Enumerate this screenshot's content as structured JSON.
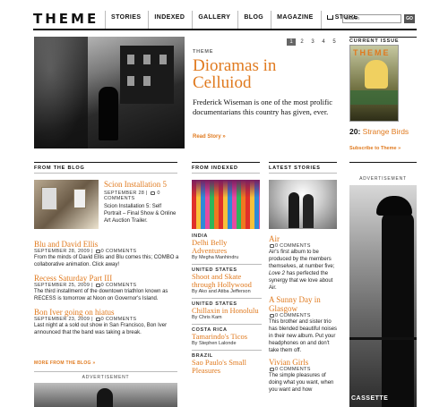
{
  "header": {
    "logo": "THEME",
    "nav": [
      "STORIES",
      "INDEXED",
      "GALLERY",
      "BLOG",
      "MAGAZINE",
      "STORE"
    ],
    "search_value": "Search",
    "go_label": "GO"
  },
  "feature": {
    "pages": [
      "1",
      "2",
      "3",
      "4",
      "5"
    ],
    "active_page": "1",
    "kicker": "THEME",
    "title": "Dioramas in Celluiod",
    "dek": "Frederick Wiseman is one of the most prolific documentarians this country has given, ever.",
    "read_more": "Read Story »"
  },
  "current_issue": {
    "label": "CURRENT ISSUE",
    "number": "20:",
    "name": "Strange Birds",
    "subscribe": "Subscribe to Theme »"
  },
  "blog": {
    "heading": "FROM THE BLOG",
    "lead": {
      "title": "Scion Installation 5",
      "date": "SEPTEMBER 28 |",
      "comments": "0",
      "comments_label": "COMMENTS",
      "excerpt": "Scion Installation 5: Self Portrait – Final Show & Online Art Auction Trailer."
    },
    "posts": [
      {
        "title": "Blu and David Ellis",
        "meta": "SEPTEMBER 28, 2009 |",
        "comments": "0 COMMENTS",
        "excerpt": "From the minds of David Ellis and Blu comes this; COMBO a collaborative animation. Click away!"
      },
      {
        "title": "Recess Saturday Part III",
        "meta": "SEPTEMBER 25, 2009 |",
        "comments": "0 COMMENTS",
        "excerpt": "The third installment of the downtown triathlon known as RECESS is tomorrow at Noon on Governor's Island."
      },
      {
        "title": "Bon Iver going on hiatus",
        "meta": "SEPTEMBER 23, 2009 |",
        "comments": "0 COMMENTS",
        "excerpt": "Last night at a sold out show in San Francisco, Bon Iver announced that the band was taking a break."
      }
    ],
    "more": "MORE FROM THE BLOG »",
    "ad_label": "ADVERTISEMENT"
  },
  "indexed": {
    "heading": "FROM INDEXED",
    "items": [
      {
        "country": "INDIA",
        "title": "Delhi Belly Adventures",
        "byline": "By Megha Manhindru"
      },
      {
        "country": "UNITED STATES",
        "title": "Shoot and Skate through Hollywood",
        "byline": "By Ako and Atiba Jefferson"
      },
      {
        "country": "UNITED STATES",
        "title": "Chillaxin in Honolulu",
        "byline": "By Chris Kam"
      },
      {
        "country": "COSTA RICA",
        "title": "Tamarindo's Ticos",
        "byline": "By Stephen Lalonde"
      },
      {
        "country": "BRAZIL",
        "title": "Sao Paulo's Small Pleasures",
        "byline": ""
      }
    ]
  },
  "latest": {
    "heading": "LATEST STORIES",
    "items": [
      {
        "title": "Air",
        "comments": "0 COMMENTS",
        "excerpt_a": "Air's first album to be produced by the members themselves, at number five; ",
        "excerpt_italic": "Love 2",
        "excerpt_b": " has perfected the synergy that we love about Air."
      },
      {
        "title": "A Sunny Day in Glasgow",
        "comments": "0 COMMENTS",
        "excerpt": "This brother and sister trio has blended beautiful noises in their new album. Put your headphones on and don't take them off."
      },
      {
        "title": "Vivian Girls",
        "comments": "0 COMMENTS",
        "excerpt": "The simple pleasures of doing what you want, when you want and how"
      }
    ]
  },
  "ad_right": {
    "label": "ADVERTISEMENT",
    "brand": "CASSETTE"
  }
}
